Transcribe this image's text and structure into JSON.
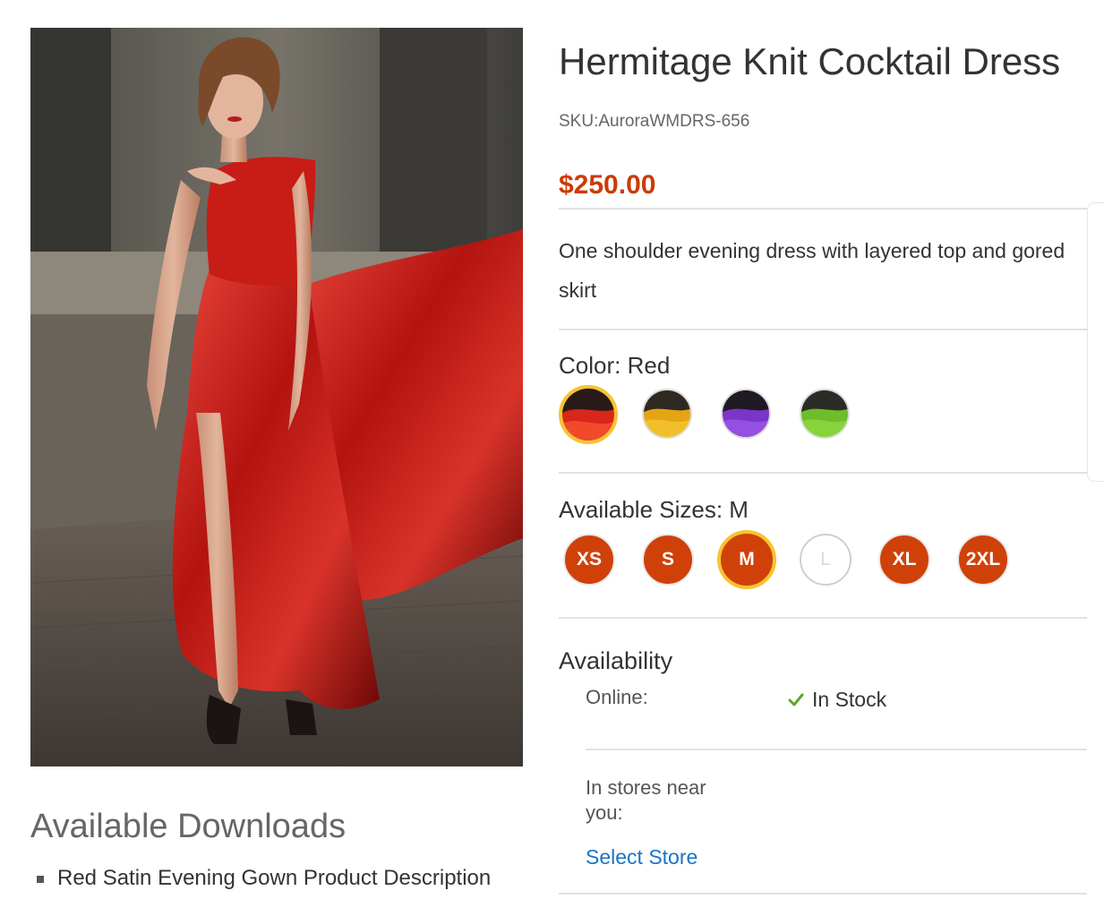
{
  "product": {
    "title": "Hermitage Knit Cocktail Dress",
    "sku": "SKU:AuroraWMDRS-656",
    "price": "$250.00",
    "description": "One shoulder evening dress with layered top and gored skirt"
  },
  "color": {
    "label": "Color: Red",
    "swatches": [
      {
        "name": "Red",
        "hex": "#d8261a",
        "selected": true
      },
      {
        "name": "Yellow",
        "hex": "#e5a512",
        "selected": false
      },
      {
        "name": "Purple",
        "hex": "#7b35c8",
        "selected": false
      },
      {
        "name": "Green",
        "hex": "#6fbd2a",
        "selected": false
      }
    ]
  },
  "sizes": {
    "label": "Available Sizes: M",
    "options": [
      {
        "label": "XS",
        "state": "available"
      },
      {
        "label": "S",
        "state": "available"
      },
      {
        "label": "M",
        "state": "selected"
      },
      {
        "label": "L",
        "state": "unavailable"
      },
      {
        "label": "XL",
        "state": "available"
      },
      {
        "label": "2XL",
        "state": "available"
      }
    ]
  },
  "availability": {
    "title": "Availability",
    "online_label": "Online:",
    "online_status": "In Stock",
    "stores_label": "In stores near you:",
    "select_store": "Select Store"
  },
  "downloads": {
    "title": "Available Downloads",
    "items": [
      "Red Satin Evening Gown Product Description"
    ]
  },
  "colors": {
    "accent": "#cc3b00",
    "selected_ring": "#f7c430",
    "link": "#1a73c7",
    "check": "#5aa828"
  }
}
